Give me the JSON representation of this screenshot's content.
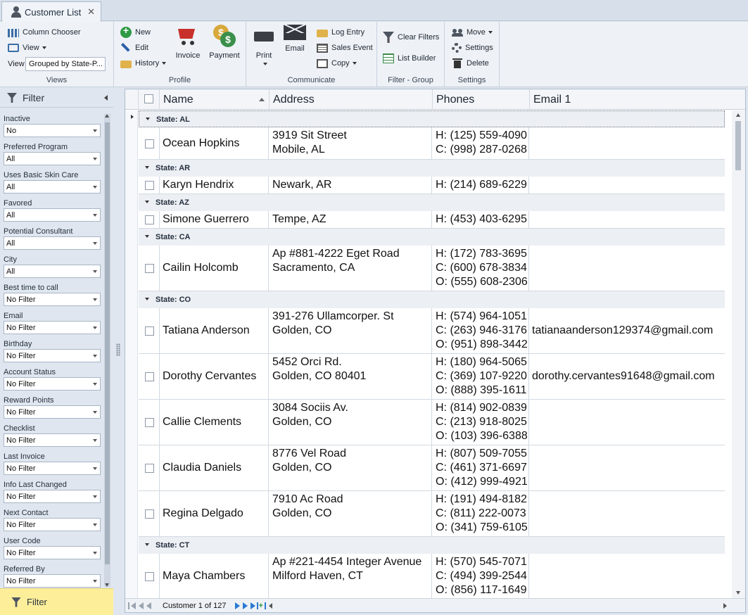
{
  "tab": {
    "title": "Customer List",
    "close": "✕"
  },
  "ribbon": {
    "views": {
      "caption": "Views",
      "column_chooser": "Column Chooser",
      "view": "View",
      "view_label": "View",
      "view_value": "Grouped by State-P..."
    },
    "profile": {
      "caption": "Profile",
      "new": "New",
      "edit": "Edit",
      "history": "History",
      "invoice": "Invoice",
      "payment": "Payment"
    },
    "communicate": {
      "caption": "Communicate",
      "print": "Print",
      "email": "Email",
      "log_entry": "Log Entry",
      "sales_event": "Sales Event",
      "copy": "Copy"
    },
    "filter_group": {
      "caption": "Filter - Group",
      "clear_filters": "Clear Filters",
      "list_builder": "List Builder"
    },
    "settings": {
      "caption": "Settings",
      "move": "Move",
      "settings": "Settings",
      "delete": "Delete"
    }
  },
  "filter_panel": {
    "title": "Filter",
    "bottom_label": "Filter",
    "filters": [
      {
        "label": "Inactive",
        "value": "No"
      },
      {
        "label": "Preferred Program",
        "value": "All"
      },
      {
        "label": "Uses Basic Skin Care",
        "value": "All"
      },
      {
        "label": "Favored",
        "value": "All"
      },
      {
        "label": "Potential Consultant",
        "value": "All"
      },
      {
        "label": "City",
        "value": "All"
      },
      {
        "label": "Best time to call",
        "value": "No Filter"
      },
      {
        "label": "Email",
        "value": "No Filter"
      },
      {
        "label": "Birthday",
        "value": "No Filter"
      },
      {
        "label": "Account Status",
        "value": "No Filter"
      },
      {
        "label": "Reward Points",
        "value": "No Filter"
      },
      {
        "label": "Checklist",
        "value": "No Filter"
      },
      {
        "label": "Last Invoice",
        "value": "No Filter"
      },
      {
        "label": "Info Last Changed",
        "value": "No Filter"
      },
      {
        "label": "Next Contact",
        "value": "No Filter"
      },
      {
        "label": "User Code",
        "value": "No Filter"
      },
      {
        "label": "Referred By",
        "value": "No Filter"
      }
    ]
  },
  "grid": {
    "columns": {
      "name": "Name",
      "address": "Address",
      "phones": "Phones",
      "email": "Email 1"
    },
    "groups": [
      {
        "label": "State: AL",
        "rows": [
          {
            "name": "Ocean Hopkins",
            "address": [
              "3919 Sit Street",
              "Mobile, AL"
            ],
            "phones": [
              "H: (125) 559-4090",
              "C: (998) 287-0268"
            ],
            "email": ""
          }
        ]
      },
      {
        "label": "State: AR",
        "rows": [
          {
            "name": "Karyn Hendrix",
            "address": [
              "Newark, AR"
            ],
            "phones": [
              "H: (214) 689-6229"
            ],
            "email": ""
          }
        ]
      },
      {
        "label": "State: AZ",
        "rows": [
          {
            "name": "Simone Guerrero",
            "address": [
              "Tempe, AZ"
            ],
            "phones": [
              "H: (453) 403-6295"
            ],
            "email": ""
          }
        ]
      },
      {
        "label": "State: CA",
        "rows": [
          {
            "name": "Cailin Holcomb",
            "address": [
              "Ap #881-4222 Eget Road",
              "Sacramento, CA"
            ],
            "phones": [
              "H: (172) 783-3695",
              "C: (600) 678-3834",
              "O: (555) 608-2306"
            ],
            "email": ""
          }
        ]
      },
      {
        "label": "State: CO",
        "rows": [
          {
            "name": "Tatiana Anderson",
            "address": [
              "391-276 Ullamcorper. St",
              "Golden, CO"
            ],
            "phones": [
              "H: (574) 964-1051",
              "C: (263) 946-3176",
              "O: (951) 898-3442"
            ],
            "email": "tatianaanderson129374@gmail.com"
          },
          {
            "name": "Dorothy Cervantes",
            "address": [
              "5452 Orci Rd.",
              "Golden, CO  80401"
            ],
            "phones": [
              "H: (180) 964-5065",
              "C: (369) 107-9220",
              "O: (888) 395-1611"
            ],
            "email": "dorothy.cervantes91648@gmail.com"
          },
          {
            "name": "Callie Clements",
            "address": [
              "3084 Sociis Av.",
              "Golden, CO"
            ],
            "phones": [
              "H: (814) 902-0839",
              "C: (213) 918-8025",
              "O: (103) 396-6388"
            ],
            "email": ""
          },
          {
            "name": "Claudia Daniels",
            "address": [
              "8776 Vel Road",
              "Golden, CO"
            ],
            "phones": [
              "H: (807) 509-7055",
              "C: (461) 371-6697",
              "O: (412) 999-4921"
            ],
            "email": ""
          },
          {
            "name": "Regina Delgado",
            "address": [
              "7910 Ac Road",
              "Golden, CO"
            ],
            "phones": [
              "H: (191) 494-8182",
              "C: (811) 222-0073",
              "O: (341) 759-6105"
            ],
            "email": ""
          }
        ]
      },
      {
        "label": "State: CT",
        "rows": [
          {
            "name": "Maya Chambers",
            "address": [
              "Ap #221-4454 Integer Avenue",
              "Milford Haven, CT"
            ],
            "phones": [
              "H: (570) 545-7071",
              "C: (494) 399-2544",
              "O: (856) 117-1649"
            ],
            "email": ""
          }
        ]
      }
    ],
    "navigator": {
      "text": "Customer 1 of 127"
    }
  }
}
